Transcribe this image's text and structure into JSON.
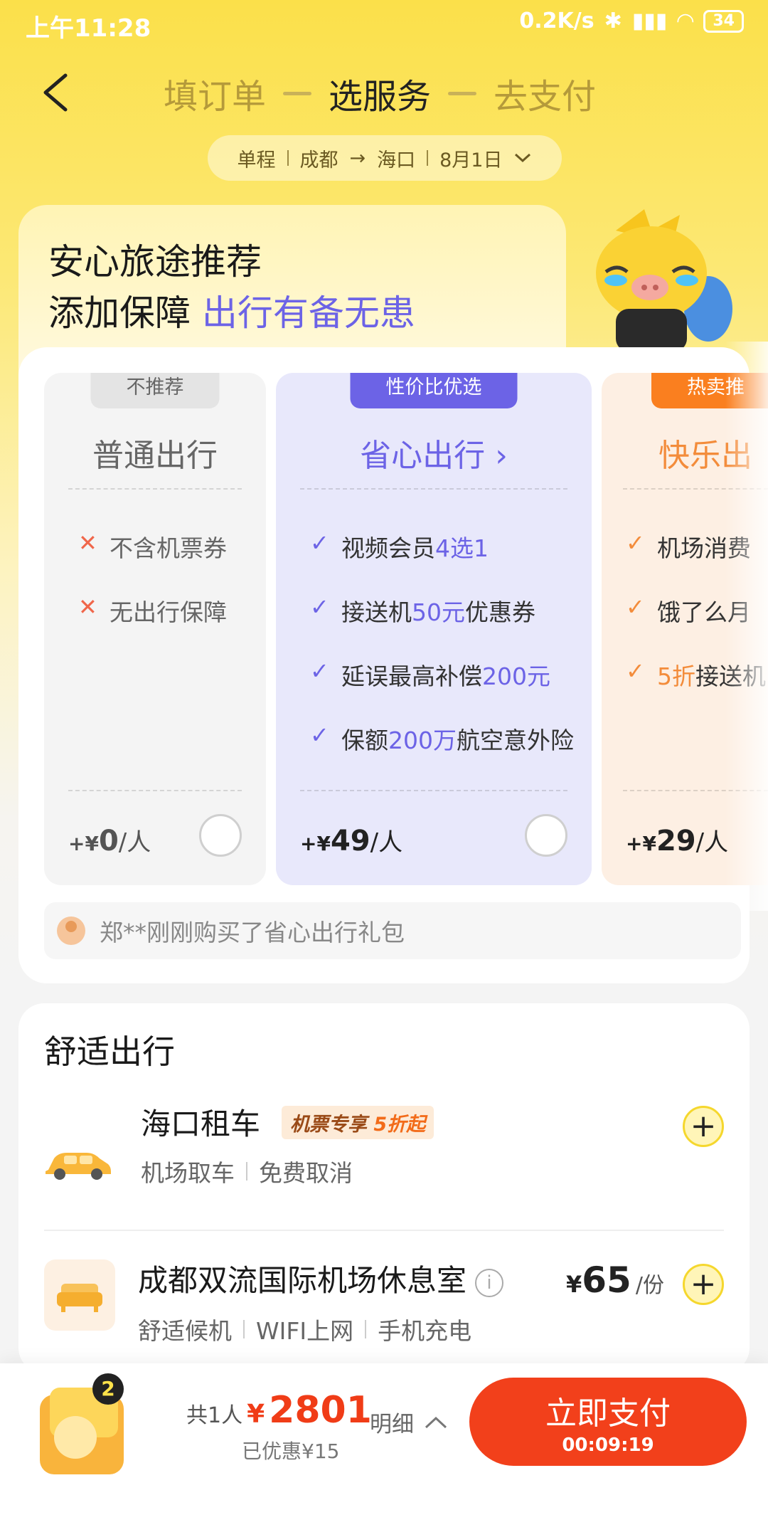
{
  "status": {
    "time": "上午11:28",
    "net_speed": "0.2K/s",
    "battery": "34"
  },
  "nav": {
    "steps": [
      "填订单",
      "选服务",
      "去支付"
    ],
    "active_step": 1
  },
  "route": {
    "trip_type": "单程",
    "from": "成都",
    "to": "海口",
    "date": "8月1日"
  },
  "recommend": {
    "title_line1": "安心旅途推荐",
    "title_line2_prefix": "添加保障",
    "title_line2_highlight": "出行有备无患",
    "plans": [
      {
        "tag": "不推荐",
        "name": "普通出行",
        "features": [
          "不含机票券",
          "无出行保障"
        ],
        "price_prefix": "+¥",
        "price": "0",
        "unit": "/人"
      },
      {
        "tag": "性价比优选",
        "name": "省心出行",
        "features": [
          {
            "a": "视频会员",
            "b": "4选1",
            "c": ""
          },
          {
            "a": "接送机",
            "b": "50元",
            "c": "优惠券"
          },
          {
            "a": "延误最高补偿",
            "b": "200元",
            "c": ""
          },
          {
            "a": "保额",
            "b": "200万",
            "c": "航空意外险"
          }
        ],
        "price_prefix": "+¥",
        "price": "49",
        "unit": "/人"
      },
      {
        "tag": "热卖推",
        "name": "快乐出",
        "features": [
          {
            "a": "机场消费",
            "b": "",
            "c": ""
          },
          {
            "a": "饿了么月",
            "b": "",
            "c": ""
          },
          {
            "a": "",
            "b": "5折",
            "c": "接送机"
          }
        ],
        "price_prefix": "+¥",
        "price": "29",
        "unit": "/人"
      }
    ],
    "ticker": "郑**刚刚购买了省心出行礼包"
  },
  "comfort": {
    "title": "舒适出行",
    "rental": {
      "title": "海口租车",
      "promo_prefix": "机票专享 ",
      "promo_highlight": "5折起",
      "sub": [
        "机场取车",
        "免费取消"
      ]
    },
    "lounge": {
      "title": "成都双流国际机场休息室",
      "sub": [
        "舒适候机",
        "WIFI上网",
        "手机充电"
      ],
      "price_prefix": "¥",
      "price": "65",
      "unit": "/份"
    }
  },
  "bottom": {
    "coupon_count": "2",
    "people": "共1人",
    "currency": "¥",
    "total": "2801",
    "saved": "已优惠¥15",
    "detail": "明细",
    "pay_label": "立即支付",
    "countdown": "00:09:19"
  },
  "colors": {
    "accent_purple": "#6C63E6",
    "accent_orange": "#F38C3B",
    "pay_red": "#F2401B",
    "brand_yellow": "#FBE04A"
  }
}
